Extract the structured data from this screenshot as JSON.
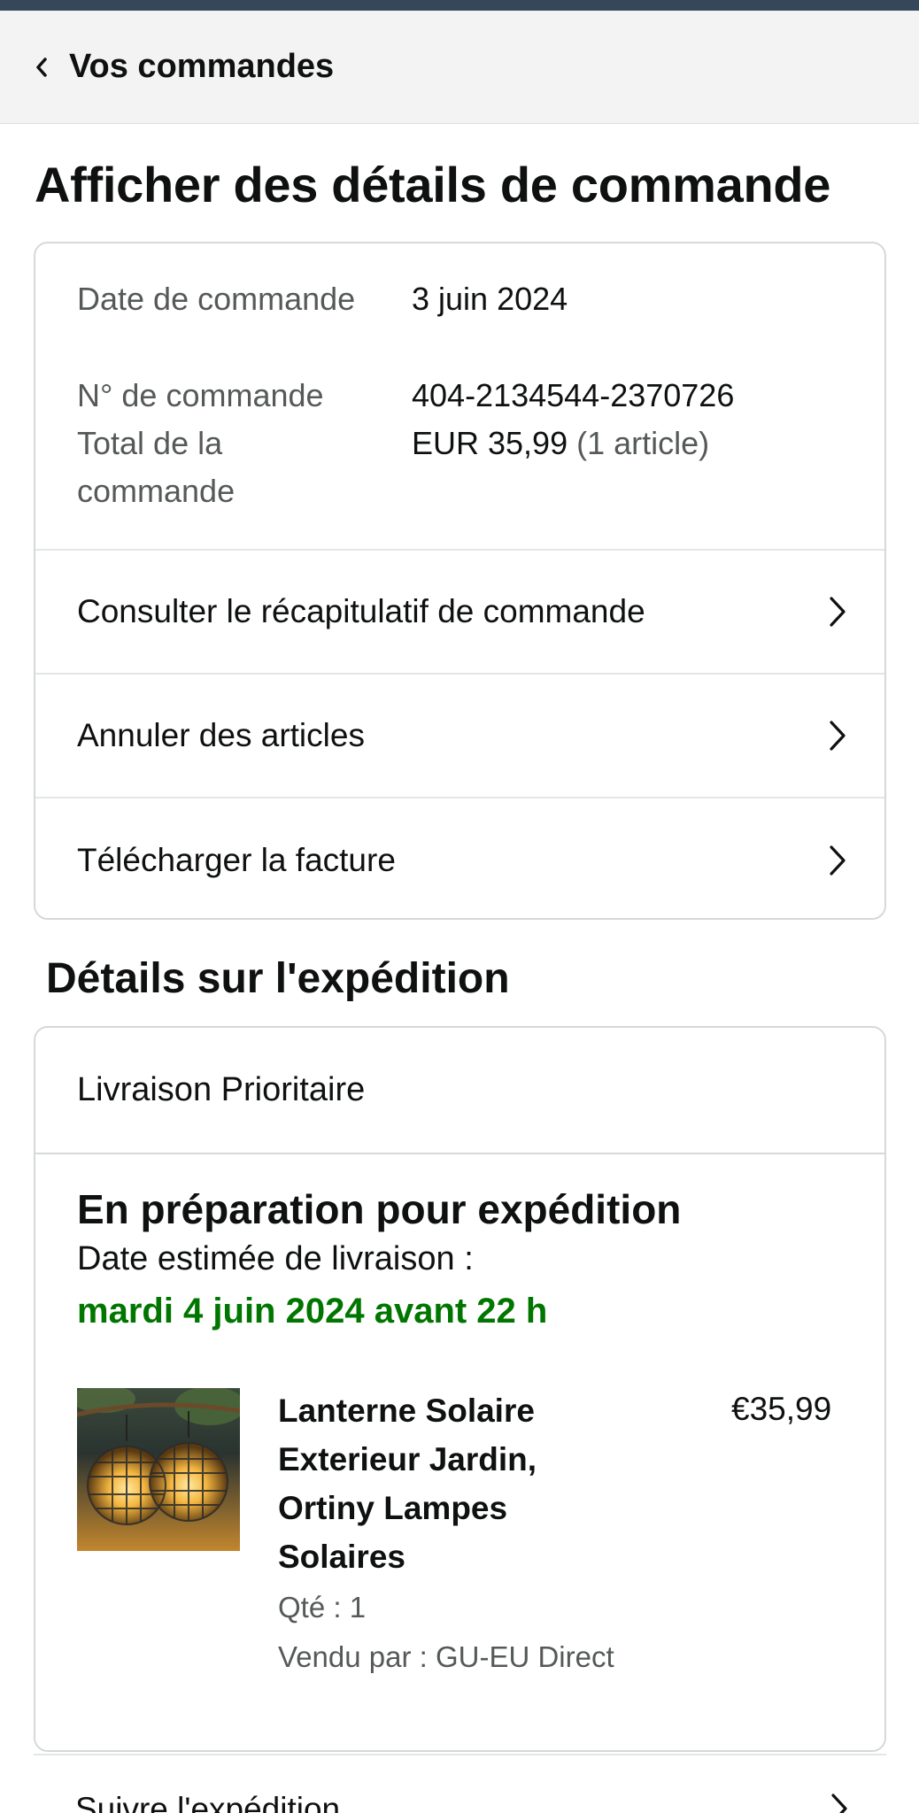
{
  "header": {
    "back_label": "Vos commandes"
  },
  "page": {
    "title": "Afficher des détails de commande"
  },
  "order": {
    "date_label": "Date de commande",
    "date_value": "3 juin 2024",
    "number_label": "N° de commande",
    "number_value": "404-2134544-2370726",
    "total_label": "Total de la commande",
    "total_value": "EUR 35,99",
    "total_count": "(1 article)",
    "actions": [
      {
        "label": "Consulter le récapitulatif de commande"
      },
      {
        "label": "Annuler des articles"
      },
      {
        "label": "Télécharger la facture"
      }
    ]
  },
  "shipment": {
    "section_title": "Détails sur l'expédition",
    "method": "Livraison Prioritaire",
    "status": "En préparation pour expédition",
    "estimate_label": "Date estimée de livraison :",
    "estimate_date": "mardi 4 juin 2024 avant 22 h",
    "estimate_color": "#007600",
    "product": {
      "name": "Lanterne Solaire Exterieur Jardin, Ortiny Lampes Solaires",
      "price": "€35,99",
      "qty": "Qté : 1",
      "seller": "Vendu par : GU-EU Direct"
    },
    "track_label": "Suivre l'expédition"
  },
  "colors": {
    "header_bg": "#f3f3f3",
    "status_bar": "#37475a",
    "border": "#d5d9d9",
    "muted_text": "#565959"
  },
  "icons": {
    "back": "chevron-left-icon",
    "row": "chevron-right-icon"
  }
}
